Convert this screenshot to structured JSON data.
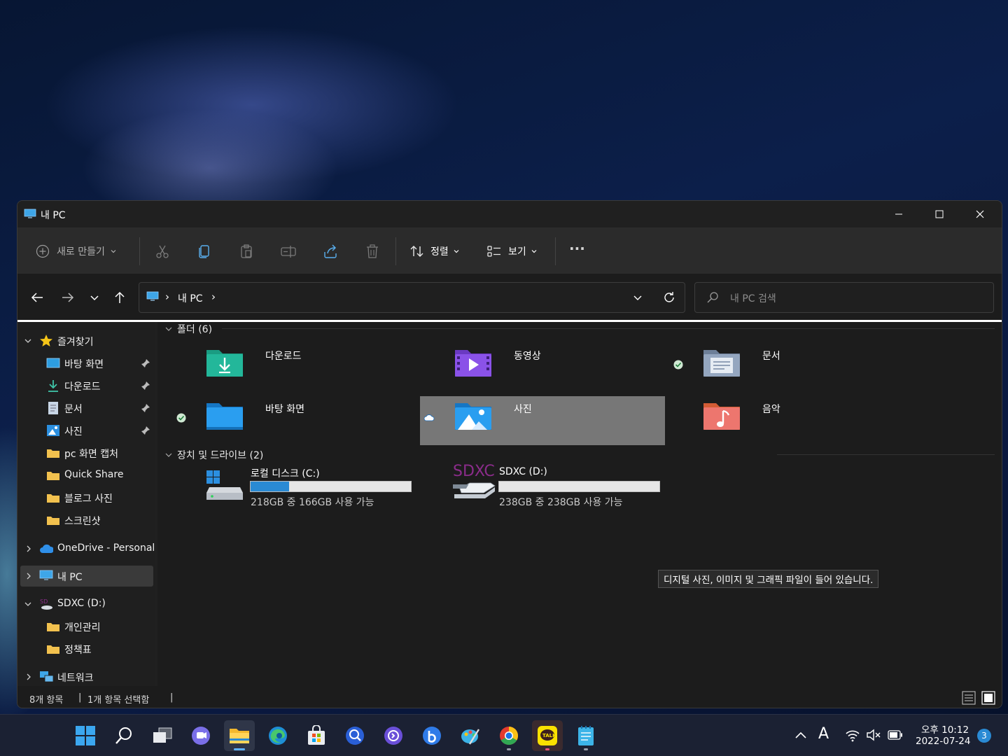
{
  "window": {
    "title": "내 PC"
  },
  "toolbar": {
    "new_label": "새로 만들기",
    "sort_label": "정렬",
    "view_label": "보기",
    "more_label": "···"
  },
  "address": {
    "path_root_sep": "›",
    "path": "내 PC",
    "path_end_sep": "›"
  },
  "search": {
    "placeholder": "내 PC 검색"
  },
  "sidebar": {
    "favorites": "즐겨찾기",
    "items": [
      {
        "label": "바탕 화면",
        "icon": "desktop-icon",
        "pinned": true
      },
      {
        "label": "다운로드",
        "icon": "download-icon",
        "pinned": true
      },
      {
        "label": "문서",
        "icon": "document-icon",
        "pinned": true
      },
      {
        "label": "사진",
        "icon": "pictures-icon",
        "pinned": true
      },
      {
        "label": "pc 화면 캡처",
        "icon": "folder-icon"
      },
      {
        "label": "Quick Share",
        "icon": "folder-icon"
      },
      {
        "label": "블로그 사진",
        "icon": "folder-icon"
      },
      {
        "label": "스크린샷",
        "icon": "folder-icon"
      }
    ],
    "onedrive": "OneDrive - Personal",
    "this_pc": "내 PC",
    "sdxc": "SDXC (D:)",
    "sdxc_items": [
      {
        "label": "개인관리"
      },
      {
        "label": "정책표"
      }
    ],
    "network": "네트워크"
  },
  "content": {
    "folders_header": "폴더 (6)",
    "folders": [
      {
        "name": "다운로드"
      },
      {
        "name": "동영상"
      },
      {
        "name": "문서"
      },
      {
        "name": "바탕 화면"
      },
      {
        "name": "사진"
      },
      {
        "name": "음악"
      }
    ],
    "drives_header": "장치 및 드라이브 (2)",
    "drives": [
      {
        "name": "로컬 디스크 (C:)",
        "info": "218GB 중 166GB 사용 가능",
        "used_fraction": 0.24
      },
      {
        "name": "SDXC (D:)",
        "info": "238GB 중 238GB 사용 가능",
        "used_fraction": 0.0,
        "logo": "SDXC"
      }
    ],
    "tooltip": "디지털 사진, 이미지 및 그래픽 파일이 들어 있습니다."
  },
  "status": {
    "count": "8개 항목",
    "selected": "1개 항목 선택함",
    "sep": "|"
  },
  "tray": {
    "ime": "A",
    "time": "오후 10:12",
    "date": "2022-07-24",
    "notifications": "3"
  },
  "colors": {
    "accent": "#2a8ad4",
    "selection": "#777777"
  }
}
